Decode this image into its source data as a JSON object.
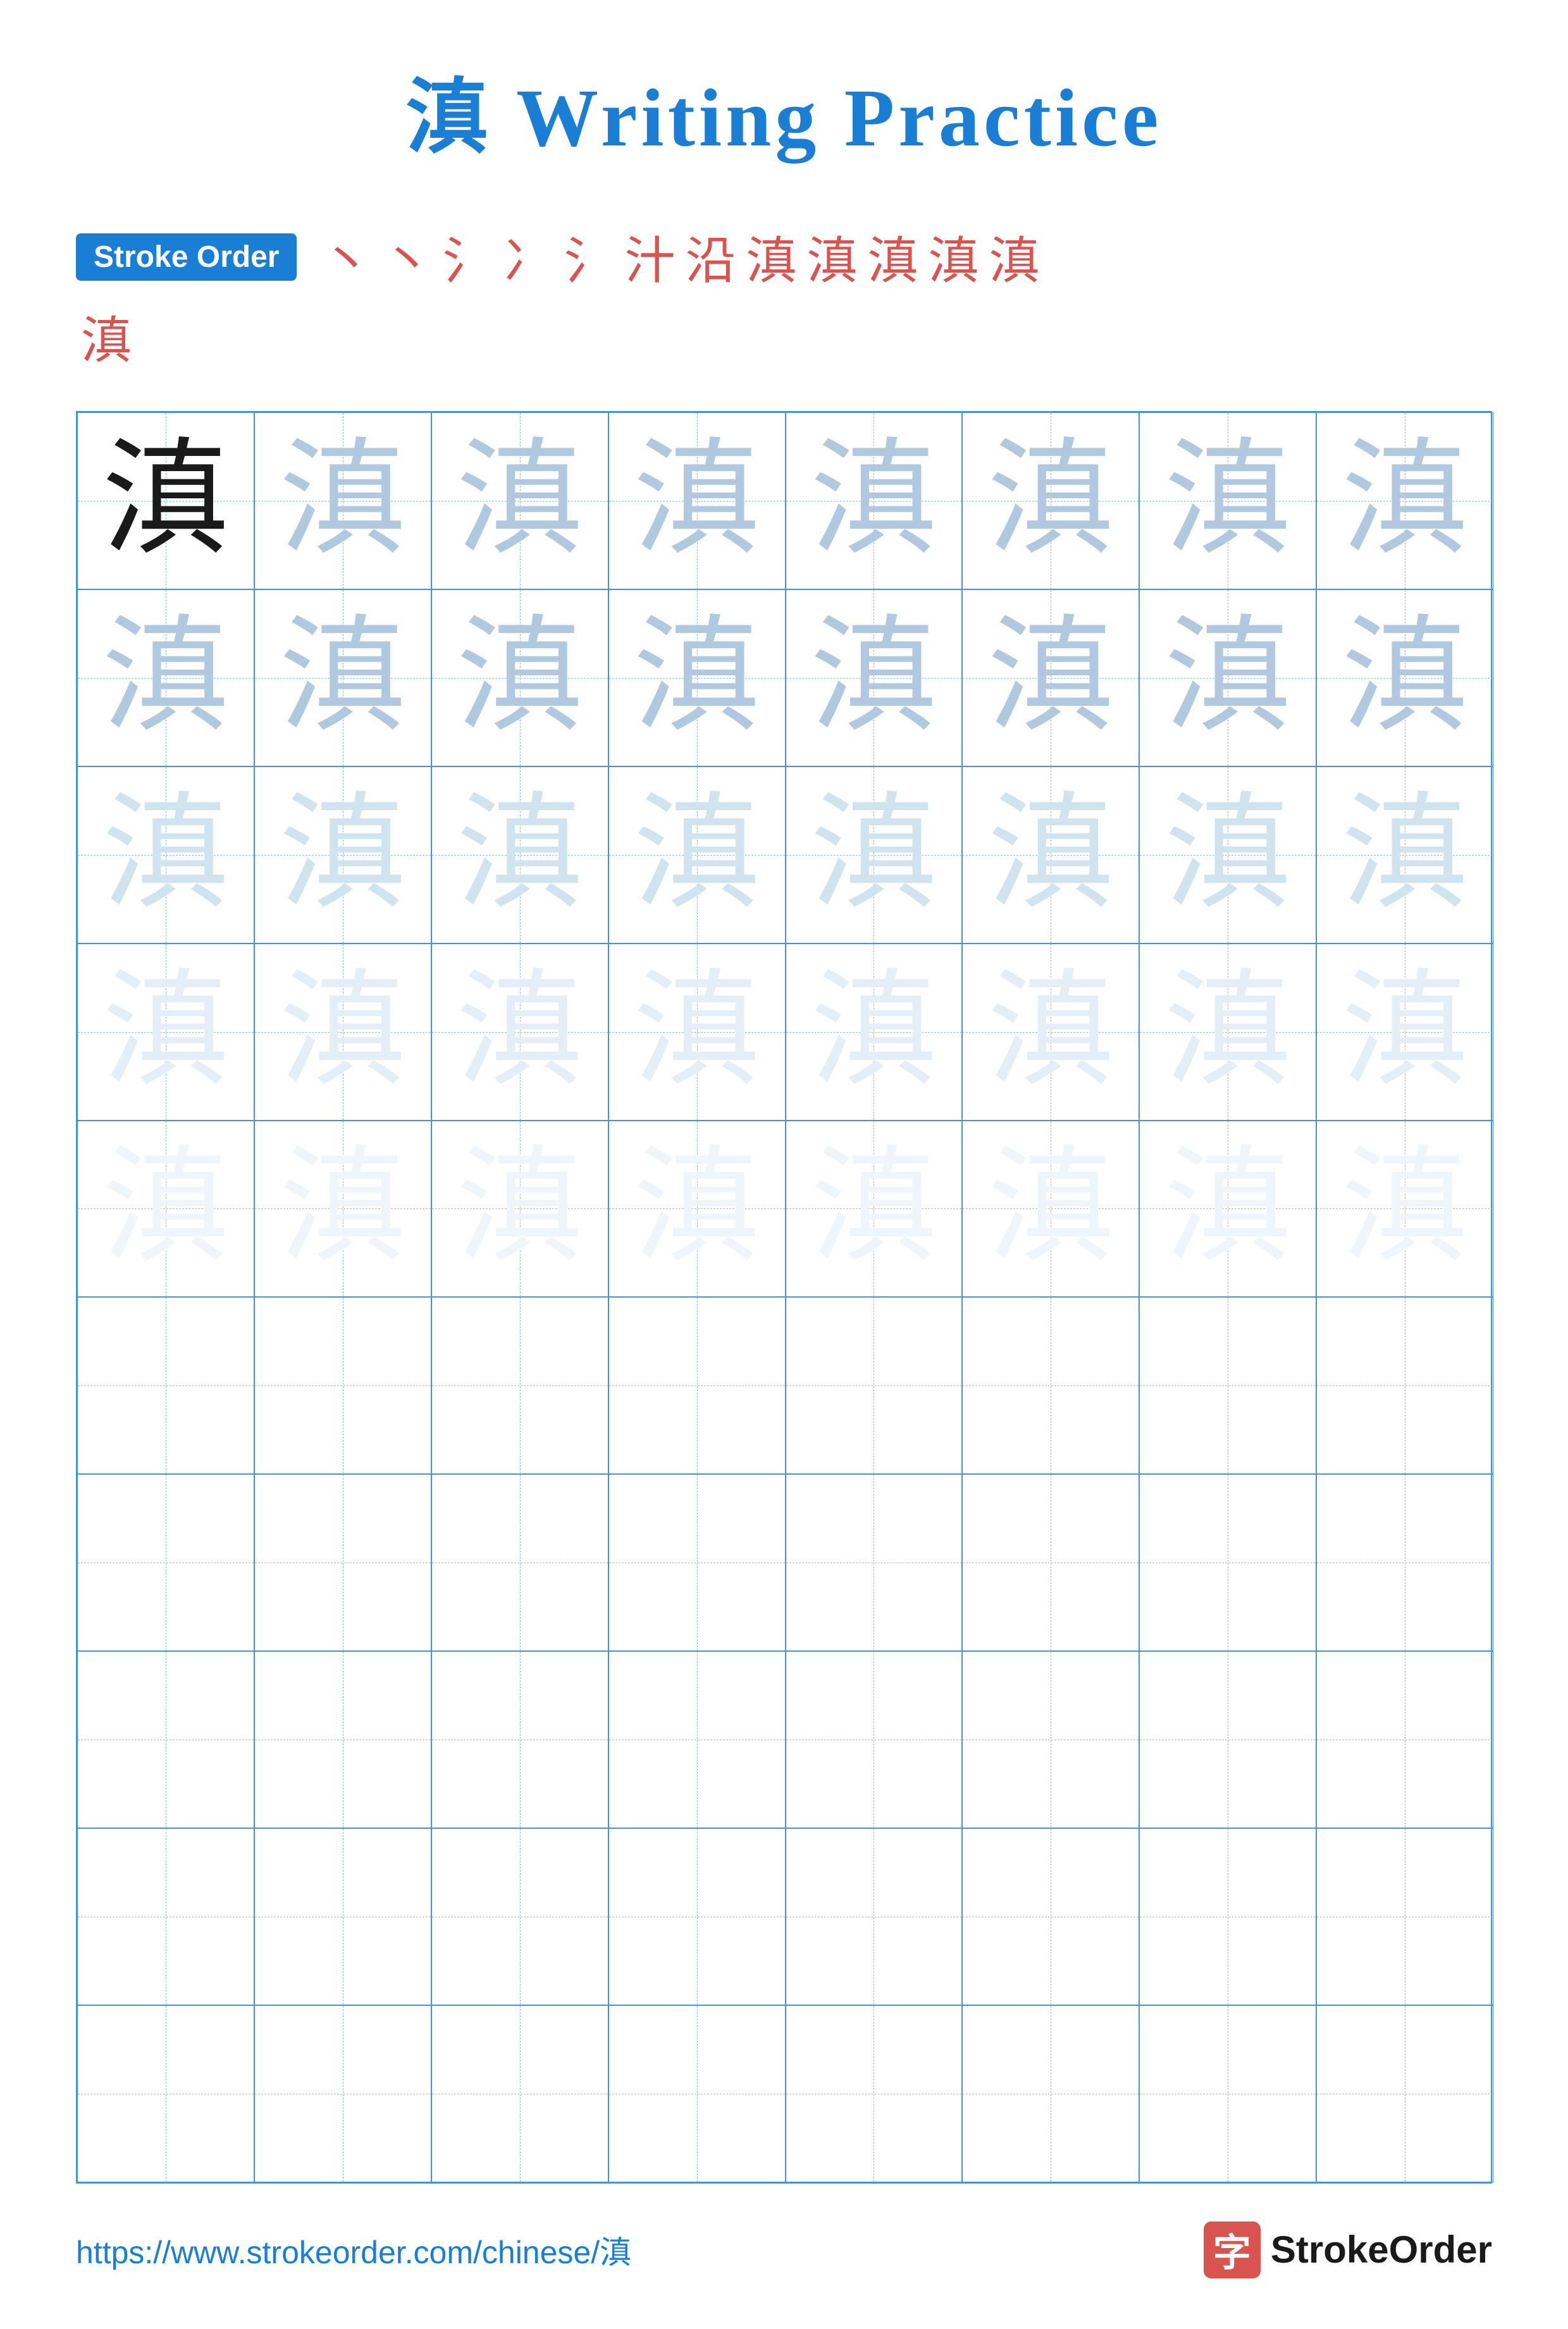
{
  "title": {
    "char": "滇",
    "text": " Writing Practice"
  },
  "stroke_order": {
    "badge_label": "Stroke Order",
    "strokes": [
      "丶",
      "丶",
      "彡",
      "冫",
      "氵",
      "汁",
      "沿",
      "滇",
      "滇",
      "滇",
      "滇",
      "滇"
    ],
    "stroke2_char": "滇"
  },
  "grid": {
    "rows": 10,
    "cols": 8,
    "practice_char": "滇",
    "filled_rows": 5,
    "char_opacities": [
      "dark",
      "medium",
      "light",
      "very-light",
      "faint"
    ]
  },
  "footer": {
    "url": "https://www.strokeorder.com/chinese/滇",
    "logo_char": "字",
    "logo_text": "StrokeOrder"
  }
}
